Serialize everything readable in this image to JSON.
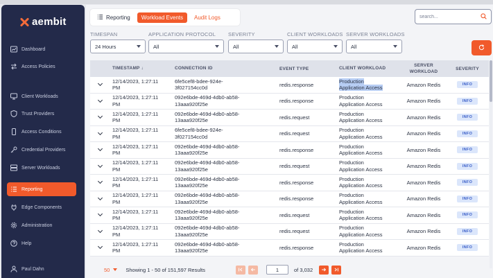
{
  "app": {
    "logo_text": "aembit",
    "brand_color": "#f15a2b"
  },
  "sidebar": {
    "items": [
      {
        "label": "Dashboard",
        "icon": "dashboard-icon"
      },
      {
        "label": "Access Policies",
        "icon": "arrows-icon"
      },
      {
        "label": "Client Workloads",
        "icon": "monitor-icon"
      },
      {
        "label": "Trust Providers",
        "icon": "shield-icon"
      },
      {
        "label": "Access Conditions",
        "icon": "phone-icon"
      },
      {
        "label": "Credential Providers",
        "icon": "key-icon"
      },
      {
        "label": "Server Workloads",
        "icon": "server-icon"
      },
      {
        "label": "Reporting",
        "icon": "list-icon",
        "active": true
      },
      {
        "label": "Edge Components",
        "icon": "plug-icon"
      },
      {
        "label": "Administration",
        "icon": "gear-icon"
      },
      {
        "label": "Help",
        "icon": "help-icon"
      },
      {
        "label": "Paul Dahn",
        "icon": "user-icon"
      }
    ]
  },
  "tabs": [
    {
      "label": "Reporting",
      "icon": "list-icon"
    },
    {
      "label": "Workload Events",
      "active": true
    },
    {
      "label": "Audit Logs"
    }
  ],
  "search": {
    "placeholder": "search..."
  },
  "filters": [
    {
      "label": "TIMESPAN",
      "value": "24 Hours"
    },
    {
      "label": "APPLICATION PROTOCOL",
      "value": "All"
    },
    {
      "label": "SEVERITY",
      "value": "All"
    },
    {
      "label": "CLIENT WORKLOADS",
      "value": "All"
    },
    {
      "label": "SERVER WORKLOADS",
      "value": "All"
    }
  ],
  "table": {
    "headers": [
      "TIMESTAMP",
      "CONNECTION ID",
      "EVENT TYPE",
      "CLIENT WORKLOAD",
      "SERVER WORKLOAD",
      "SEVERITY"
    ],
    "sort_indicator": "↓",
    "rows": [
      {
        "ts1": "12/14/2023, 1:27:11",
        "ts2": "PM",
        "id1": "6fe5cef8-bdee-924e-",
        "id2": "3f027154cc0d",
        "event": "redis.response",
        "cw1": "Production",
        "cw2": "Application Access",
        "sw": "Amazon Redis",
        "sev": "INFO"
      },
      {
        "ts1": "12/14/2023, 1:27:11",
        "ts2": "PM",
        "id1": "092e6bde-469d-4db0-ab58-",
        "id2": "13aaa920f25e",
        "event": "redis.response",
        "cw1": "Production",
        "cw2": "Application Access",
        "sw": "Amazon Redis",
        "sev": "INFO"
      },
      {
        "ts1": "12/14/2023, 1:27:11",
        "ts2": "PM",
        "id1": "092e6bde-469d-4db0-ab58-",
        "id2": "13aaa920f25e",
        "event": "redis.request",
        "cw1": "Production",
        "cw2": "Application Access",
        "sw": "Amazon Redis",
        "sev": "INFO"
      },
      {
        "ts1": "12/14/2023, 1:27:11",
        "ts2": "PM",
        "id1": "6fe5cef8-bdee-924e-",
        "id2": "3f027154cc0d",
        "event": "redis.request",
        "cw1": "Production",
        "cw2": "Application Access",
        "sw": "Amazon Redis",
        "sev": "INFO"
      },
      {
        "ts1": "12/14/2023, 1:27:11",
        "ts2": "PM",
        "id1": "092e6bde-469d-4db0-ab58-",
        "id2": "13aaa920f25e",
        "event": "redis.response",
        "cw1": "Production",
        "cw2": "Application Access",
        "sw": "Amazon Redis",
        "sev": "INFO"
      },
      {
        "ts1": "12/14/2023, 1:27:11",
        "ts2": "PM",
        "id1": "092e6bde-469d-4db0-ab58-",
        "id2": "13aaa920f25e",
        "event": "redis.request",
        "cw1": "Production",
        "cw2": "Application Access",
        "sw": "Amazon Redis",
        "sev": "INFO"
      },
      {
        "ts1": "12/14/2023, 1:27:11",
        "ts2": "PM",
        "id1": "092e6bde-469d-4db0-ab58-",
        "id2": "13aaa920f25e",
        "event": "redis.response",
        "cw1": "Production",
        "cw2": "Application Access",
        "sw": "Amazon Redis",
        "sev": "INFO"
      },
      {
        "ts1": "12/14/2023, 1:27:11",
        "ts2": "PM",
        "id1": "092e6bde-469d-4db0-ab58-",
        "id2": "13aaa920f25e",
        "event": "redis.response",
        "cw1": "Production",
        "cw2": "Application Access",
        "sw": "Amazon Redis",
        "sev": "INFO"
      },
      {
        "ts1": "12/14/2023, 1:27:11",
        "ts2": "PM",
        "id1": "092e6bde-469d-4db0-ab58-",
        "id2": "13aaa920f25e",
        "event": "redis.request",
        "cw1": "Production",
        "cw2": "Application Access",
        "sw": "Amazon Redis",
        "sev": "INFO"
      },
      {
        "ts1": "12/14/2023, 1:27:11",
        "ts2": "PM",
        "id1": "092e6bde-469d-4db0-ab58-",
        "id2": "13aaa920f25e",
        "event": "redis.request",
        "cw1": "Production",
        "cw2": "Application Access",
        "sw": "Amazon Redis",
        "sev": "INFO"
      },
      {
        "ts1": "12/14/2023, 1:27:11",
        "ts2": "PM",
        "id1": "092e6bde-469d-4db0-ab58-",
        "id2": "13aaa920f25e",
        "event": "redis.response",
        "cw1": "Production",
        "cw2": "Application Access",
        "sw": "Amazon Redis",
        "sev": "INFO"
      }
    ]
  },
  "pagination": {
    "per_page": "50",
    "showing": "Showing 1 - 50 of 151,597 Results",
    "current_page": "1",
    "of_pages": "of 3,032"
  }
}
